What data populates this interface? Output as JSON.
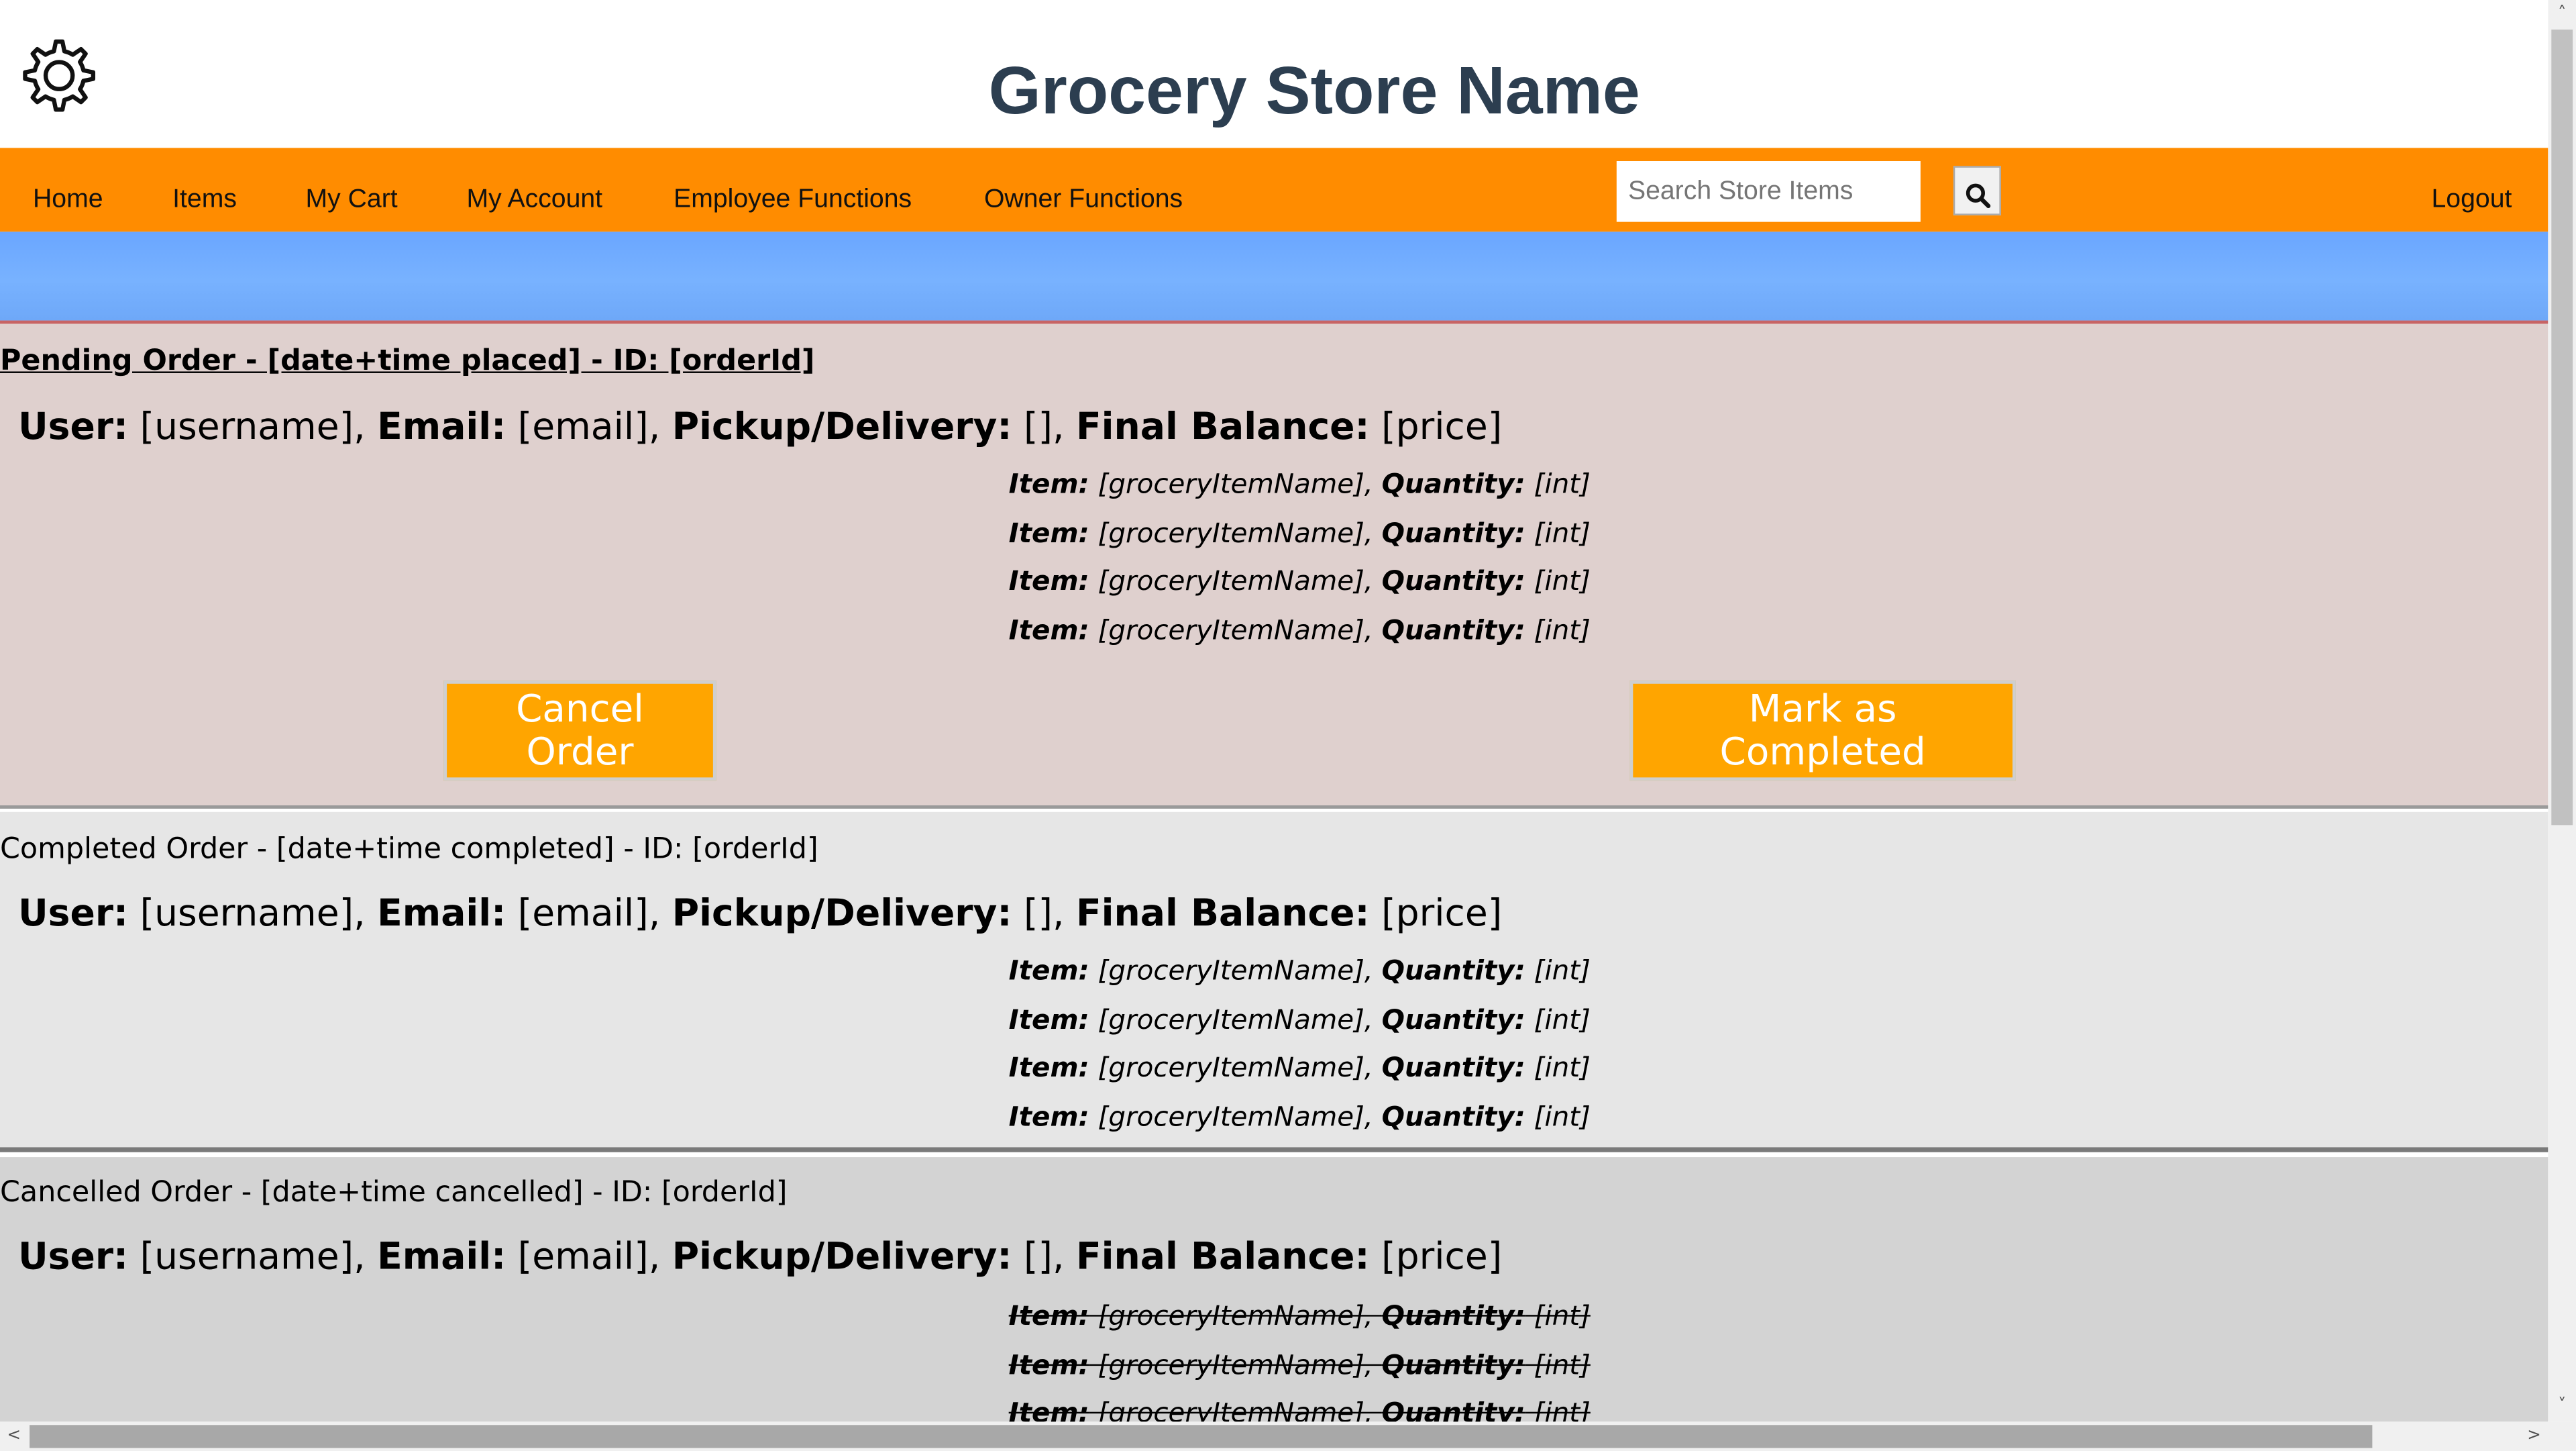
{
  "header": {
    "title": "Grocery Store Name",
    "settings_icon": "gear-icon"
  },
  "nav": {
    "items": [
      {
        "label": "Home"
      },
      {
        "label": "Items"
      },
      {
        "label": "My Cart"
      },
      {
        "label": "My Account"
      },
      {
        "label": "Employee Functions"
      },
      {
        "label": "Owner Functions"
      }
    ],
    "search_placeholder": "Search Store Items",
    "search_icon": "search-icon",
    "logout_label": "Logout",
    "background_color": "#ff8c00"
  },
  "orders": {
    "pending": {
      "heading": "Pending Order - [date+time placed] - ID: [orderId]",
      "user_label": "User:",
      "user_value": " [username], ",
      "email_label": "Email:",
      "email_value": " [email], ",
      "pickup_label": "Pickup/Delivery:",
      "pickup_value": " [], ",
      "balance_label": "Final Balance:",
      "balance_value": " [price]",
      "items": [
        {
          "item_label": "Item:",
          "item_value": " [groceryItemName], ",
          "qty_label": "Quantity:",
          "qty_value": " [int]"
        },
        {
          "item_label": "Item:",
          "item_value": " [groceryItemName], ",
          "qty_label": "Quantity:",
          "qty_value": " [int]"
        },
        {
          "item_label": "Item:",
          "item_value": " [groceryItemName], ",
          "qty_label": "Quantity:",
          "qty_value": " [int]"
        },
        {
          "item_label": "Item:",
          "item_value": " [groceryItemName], ",
          "qty_label": "Quantity:",
          "qty_value": " [int]"
        }
      ],
      "cancel_button": "Cancel Order",
      "complete_button": "Mark as Completed"
    },
    "completed": {
      "heading": "Completed Order - [date+time completed] - ID: [orderId]",
      "user_label": "User:",
      "user_value": " [username], ",
      "email_label": "Email:",
      "email_value": " [email], ",
      "pickup_label": "Pickup/Delivery:",
      "pickup_value": " [], ",
      "balance_label": "Final Balance:",
      "balance_value": " [price]",
      "items": [
        {
          "item_label": "Item:",
          "item_value": " [groceryItemName], ",
          "qty_label": "Quantity:",
          "qty_value": " [int]"
        },
        {
          "item_label": "Item:",
          "item_value": " [groceryItemName], ",
          "qty_label": "Quantity:",
          "qty_value": " [int]"
        },
        {
          "item_label": "Item:",
          "item_value": " [groceryItemName], ",
          "qty_label": "Quantity:",
          "qty_value": " [int]"
        },
        {
          "item_label": "Item:",
          "item_value": " [groceryItemName], ",
          "qty_label": "Quantity:",
          "qty_value": " [int]"
        }
      ]
    },
    "cancelled": {
      "heading": "Cancelled Order - [date+time cancelled] - ID: [orderId]",
      "user_label": "User:",
      "user_value": " [username], ",
      "email_label": "Email:",
      "email_value": " [email], ",
      "pickup_label": "Pickup/Delivery:",
      "pickup_value": " [], ",
      "balance_label": "Final Balance:",
      "balance_value": " [price]",
      "items": [
        {
          "item_label": "Item:",
          "item_value": " [groceryItemName], ",
          "qty_label": "Quantity:",
          "qty_value": " [int]"
        },
        {
          "item_label": "Item:",
          "item_value": " [groceryItemName], ",
          "qty_label": "Quantity:",
          "qty_value": " [int]"
        },
        {
          "item_label": "Item:",
          "item_value": " [groceryItemName], ",
          "qty_label": "Quantity:",
          "qty_value": " [int]"
        }
      ]
    }
  },
  "colors": {
    "pending_bg": "#dfd0ce",
    "completed_bg": "#e6e6e6",
    "cancelled_bg": "#d3d3d3",
    "button_orange": "#ffa500",
    "banner_blue": "#6aa6ff",
    "title_color": "#2c3e50"
  },
  "scrollbars": {
    "up_arrow": "˄",
    "down_arrow": "˅",
    "left_arrow": "<",
    "right_arrow": ">"
  }
}
